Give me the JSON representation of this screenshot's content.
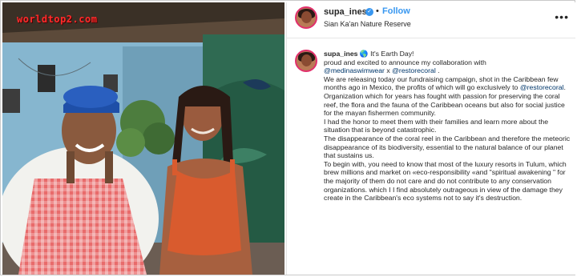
{
  "watermark": "worldtop2.com",
  "post": {
    "username": "supa_ines",
    "follow_label": "Follow",
    "separator": "•",
    "location": "Sian Ka'an Nature Reserve",
    "more_icon": "more-horizontal-icon",
    "verified_icon": "verified-badge-icon"
  },
  "caption": {
    "username": "supa_ines",
    "emoji": "🌎",
    "line1": "It's Earth Day!",
    "line2": "proud and excited to announce my collaboration with",
    "mention1": "@medinaswimwear",
    "x_text": " x ",
    "mention2": "@restorecoral",
    "line3_end": " .",
    "p1_start": "We are releasing today our fundraising campaign, shot in the Caribbean few months ago in Mexico, the profits of which will go exclusively to ",
    "p1_mention": "@restorecoral",
    "p1_end": ". Organization which for years has fought with passion for preserving the coral reef, the flora and the fauna of the Caribbean oceans but also for social justice for the mayan fishermen community.",
    "p2": "I had the honor to meet them with their families and learn more about the situation that is beyond catastrophic.",
    "p3": "The disappearance of the coral reel in the Caribbean and therefore the meteoric disappearance of its biodiversity, essential to the natural balance of our planet that sustains us.",
    "p4": "To begin with, you need to know that most of the luxury resorts in Tulum, which brew millions and market on «eco-responsibility «and \"spiritual awakening \" for the majority of them do not care and do not contribute to any conservation organizations. which I I find absolutely outrageous in view of the damage they create in the Caribbean's eco systems not to say it's destruction."
  },
  "colors": {
    "link": "#3897f0",
    "mention": "#00376b",
    "text": "#262626",
    "story_ring": "#e1306c"
  }
}
